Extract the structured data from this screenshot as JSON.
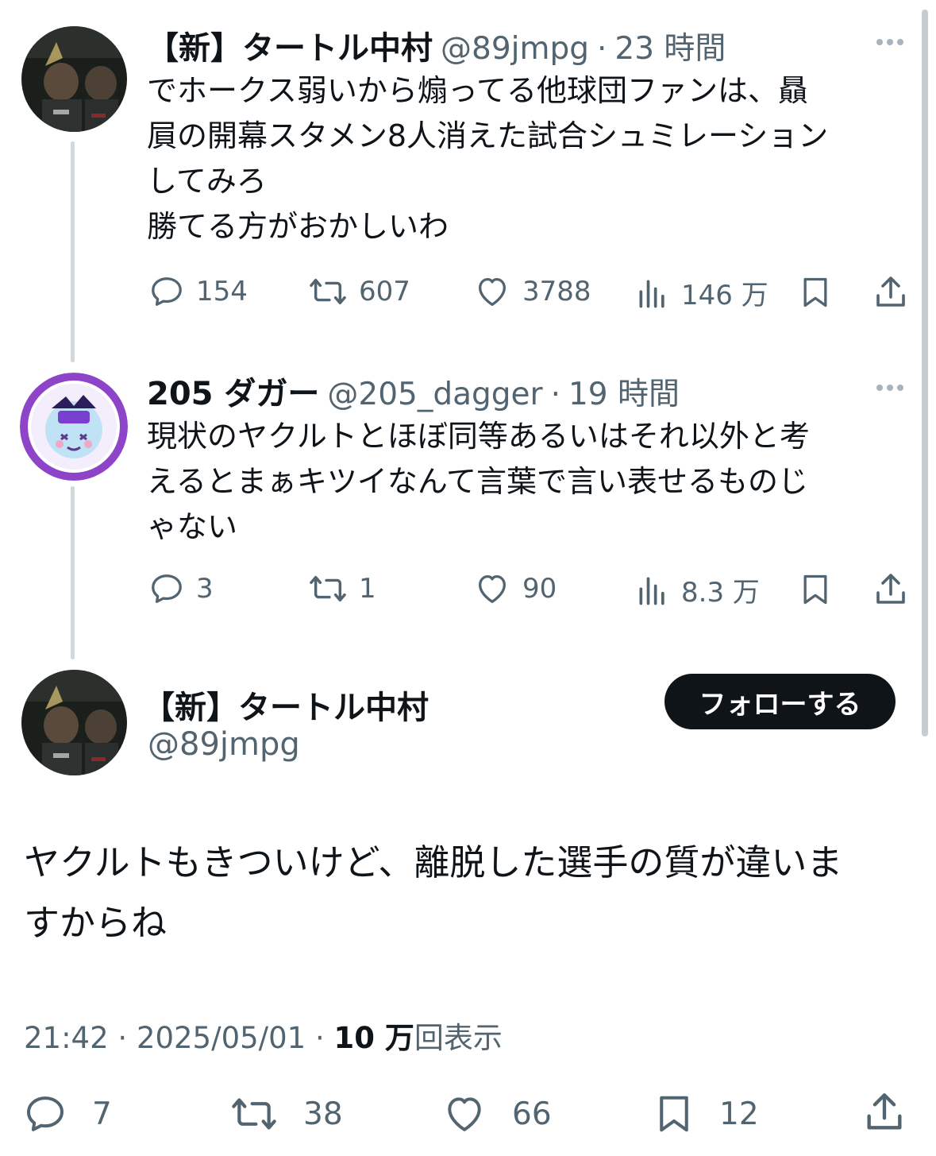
{
  "tweet1": {
    "name": "【新】タートル中村",
    "handle": "@89jmpg",
    "time": "23 時間",
    "lines": [
      "でホークス弱いから煽ってる他球団ファンは、贔",
      "屓の開幕スタメン8人消えた試合シュミレーション",
      "してみろ",
      "勝てる方がおかしいわ"
    ],
    "replies": "154",
    "retweets": "607",
    "likes": "3788",
    "views": "146 万"
  },
  "tweet2": {
    "name": "205 ダガー",
    "handle": "@205_dagger",
    "time": "19 時間",
    "lines": [
      "現状のヤクルトとほぼ同等あるいはそれ以外と考",
      "えるとまぁキツイなんて言葉で言い表せるものじ",
      "ゃない"
    ],
    "replies": "3",
    "retweets": "1",
    "likes": "90",
    "views": "8.3 万"
  },
  "main": {
    "name": "【新】タートル中村",
    "handle": "@89jmpg",
    "follow_label": "フォローする",
    "lines": [
      "ヤクルトもきついけど、離脱した選手の質が違いま",
      "すからね"
    ],
    "time": "21:42",
    "date": "2025/05/01",
    "view_count": "10 万",
    "view_suffix": "回表示",
    "replies": "7",
    "retweets": "38",
    "likes": "66",
    "bookmarks": "12"
  },
  "icons": {
    "reply": "speech-bubble-icon",
    "retweet": "retweet-arrows-icon",
    "like": "heart-icon",
    "views": "bar-chart-icon",
    "bookmark": "bookmark-icon",
    "share": "share-upload-icon",
    "more": "more-dots-icon"
  },
  "colors": {
    "text": "#0f1419",
    "secondary": "#536471",
    "thread_line": "#cfd9de",
    "follow_button": "#0f1419",
    "avatar2_ring": "#8e44c9"
  }
}
